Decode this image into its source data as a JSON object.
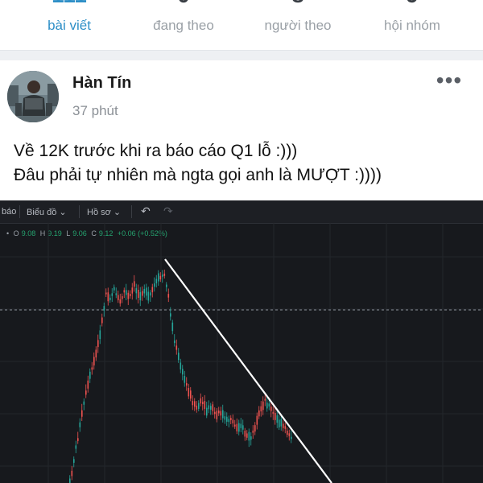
{
  "tabs": [
    {
      "label": "bài viết",
      "active": true
    },
    {
      "label": "đang theo",
      "active": false
    },
    {
      "label": "người theo",
      "active": false
    },
    {
      "label": "hội nhóm",
      "active": false
    }
  ],
  "post": {
    "author": "Hàn Tín",
    "time": "37 phút",
    "text_lines": [
      "Về 12K trước khi ra báo cáo Q1 lỗ :)))",
      "Đâu phải tự nhiên mà ngta gọi anh là MƯỢT :))))"
    ]
  },
  "chart_toolbar": {
    "item_bao": "báo",
    "item_bieudo": "Biểu đồ",
    "item_hoso": "Hồ sơ"
  },
  "ohlc": {
    "o_key": "O",
    "o_val": "9.08",
    "h_key": "H",
    "h_val": "9.19",
    "l_key": "L",
    "l_val": "9.06",
    "c_key": "C",
    "c_val": "9.12",
    "change": "+0.06 (+0.52%)"
  },
  "colors": {
    "accent": "#2e8fc7",
    "candle_up": "#26a69a",
    "candle_down": "#ef5350",
    "chart_bg": "#17191d"
  },
  "chart_data": {
    "type": "candlestick",
    "note_visible": "price chart with down trendline drawn",
    "trend": [
      "rise",
      "peak",
      "decline",
      "consolidation"
    ]
  }
}
